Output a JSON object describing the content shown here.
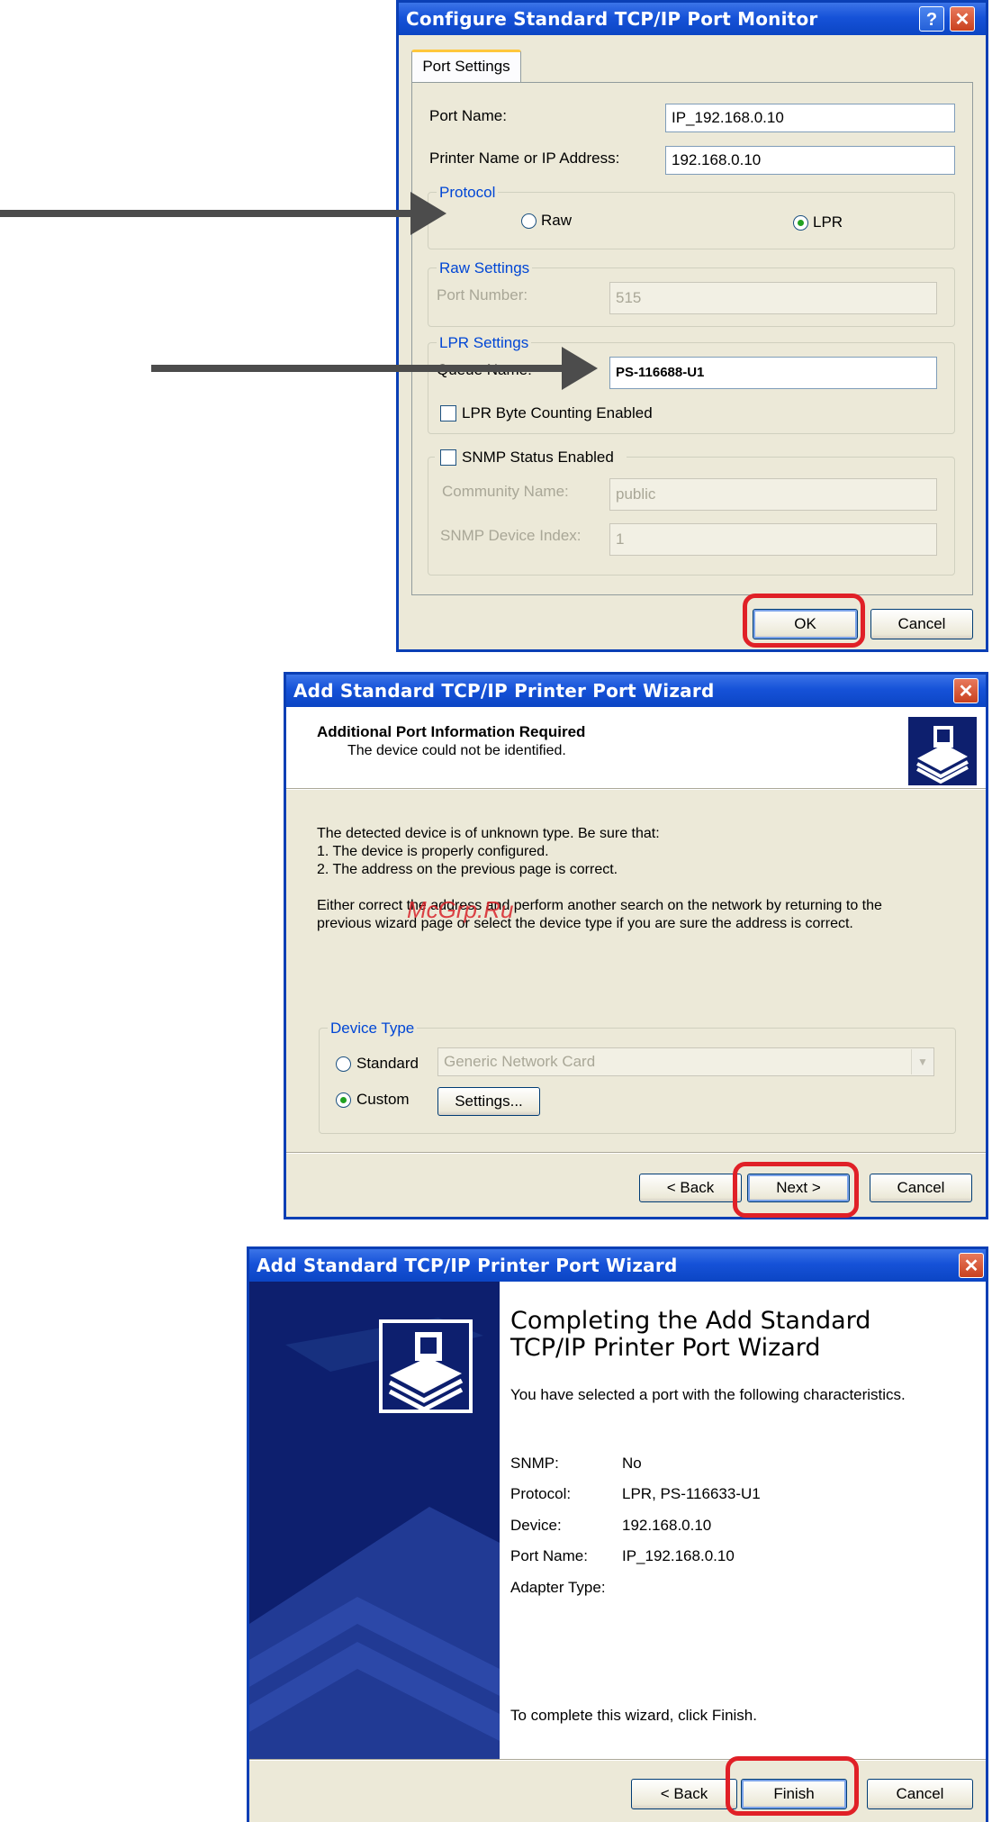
{
  "win1": {
    "title": "Configure Standard TCP/IP Port Monitor",
    "help_label": "?",
    "close_label": "✕",
    "tab_label": "Port Settings",
    "port_name_label": "Port Name:",
    "port_name_value": "IP_192.168.0.10",
    "printer_ip_label": "Printer Name or IP Address:",
    "printer_ip_value": "192.168.0.10",
    "protocol_legend": "Protocol",
    "raw_label": "Raw",
    "lpr_label": "LPR",
    "selected_protocol": "LPR",
    "raw_settings_legend": "Raw Settings",
    "port_number_label": "Port Number:",
    "port_number_value": "515",
    "lpr_settings_legend": "LPR Settings",
    "queue_name_label": "Queue Name:",
    "queue_name_value": "PS-116688-U1",
    "lpr_byte_label": "LPR Byte Counting Enabled",
    "snmp_label": "SNMP Status Enabled",
    "community_label": "Community Name:",
    "community_value": "public",
    "snmp_index_label": "SNMP Device Index:",
    "snmp_index_value": "1",
    "ok_label": "OK",
    "cancel_label": "Cancel"
  },
  "win2": {
    "title": "Add Standard TCP/IP Printer Port Wizard",
    "close_label": "✕",
    "header_title": "Additional Port Information Required",
    "header_subtitle": "The device could not be identified.",
    "body_lines": [
      "The detected device is of unknown type.  Be sure that:",
      "1. The device is properly configured.",
      "2.  The address on the previous page is correct."
    ],
    "body_para": [
      "Either correct the address and perform another search on the network by returning to the",
      "previous wizard page or select the device type if you are sure the address is correct."
    ],
    "watermark": "McGrp.Ru",
    "device_type_legend": "Device Type",
    "standard_label": "Standard",
    "standard_value": "Generic Network Card",
    "custom_label": "Custom",
    "settings_label": "Settings...",
    "selected_device_type": "Custom",
    "back_label": "< Back",
    "next_label": "Next >",
    "cancel_label": "Cancel"
  },
  "win3": {
    "title": "Add Standard TCP/IP Printer Port Wizard",
    "close_label": "✕",
    "heading_line1": "Completing the Add Standard",
    "heading_line2": "TCP/IP Printer Port Wizard",
    "intro": "You have selected a port with the following characteristics.",
    "details": [
      {
        "key": "SNMP:",
        "value": "No"
      },
      {
        "key": "Protocol:",
        "value": "LPR, PS-116633-U1"
      },
      {
        "key": "Device:",
        "value": "192.168.0.10"
      },
      {
        "key": "Port Name:",
        "value": "IP_192.168.0.10"
      },
      {
        "key": "Adapter Type:",
        "value": ""
      }
    ],
    "finish_text": "To complete this wizard, click Finish.",
    "back_label": "< Back",
    "finish_label": "Finish",
    "cancel_label": "Cancel"
  },
  "colors": {
    "title_blue": "#0b45c4",
    "highlight_red": "#e02027",
    "arrow_gray": "#4c4c4c",
    "wizard_sidebar": "#0d1f6e"
  }
}
